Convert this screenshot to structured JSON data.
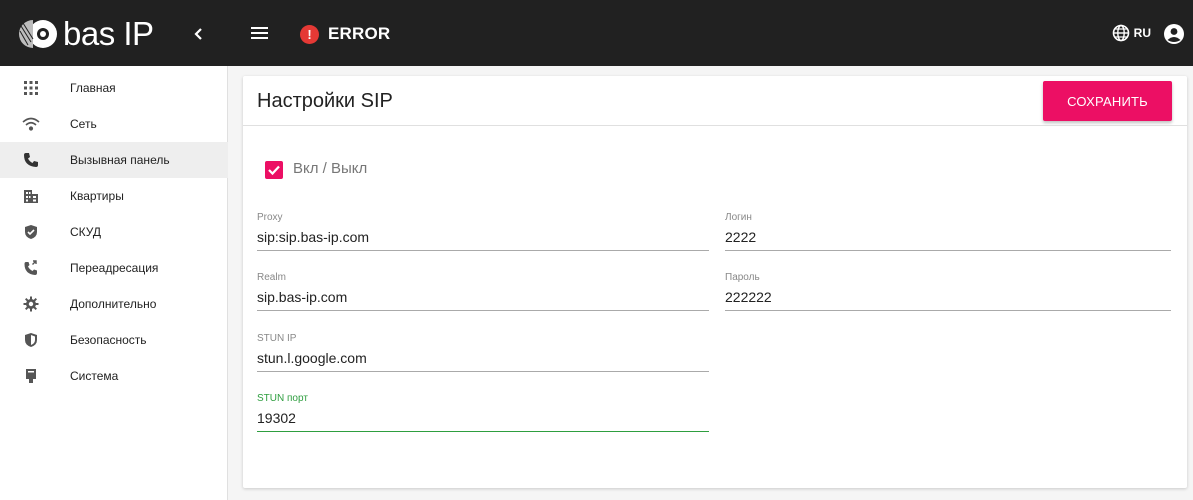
{
  "header": {
    "logo_text": "bas IP",
    "error_label": "ERROR",
    "language": "RU"
  },
  "sidebar": {
    "items": [
      {
        "label": "Главная",
        "icon": "apps-grid-icon",
        "active": false
      },
      {
        "label": "Сеть",
        "icon": "wifi-icon",
        "active": false
      },
      {
        "label": "Вызывная панель",
        "icon": "phone-icon",
        "active": true
      },
      {
        "label": "Квартиры",
        "icon": "building-icon",
        "active": false
      },
      {
        "label": "СКУД",
        "icon": "shield-check-icon",
        "active": false
      },
      {
        "label": "Переадресация",
        "icon": "phone-forward-icon",
        "active": false
      },
      {
        "label": "Дополнительно",
        "icon": "gear-icon",
        "active": false
      },
      {
        "label": "Безопасность",
        "icon": "security-shield-icon",
        "active": false
      },
      {
        "label": "Система",
        "icon": "device-icon",
        "active": false
      }
    ]
  },
  "main": {
    "title": "Настройки SIP",
    "save_label": "СОХРАНИТЬ",
    "enable_label": "Вкл / Выкл",
    "enable_checked": true,
    "fields": {
      "proxy": {
        "label": "Proxy",
        "value": "sip:sip.bas-ip.com"
      },
      "login": {
        "label": "Логин",
        "value": "2222"
      },
      "realm": {
        "label": "Realm",
        "value": "sip.bas-ip.com"
      },
      "password": {
        "label": "Пароль",
        "value": "222222"
      },
      "stun_ip": {
        "label": "STUN IP",
        "value": "stun.l.google.com"
      },
      "stun_port": {
        "label": "STUN порт",
        "value": "19302"
      }
    }
  },
  "colors": {
    "accent": "#ec0f64",
    "focus": "#2e9e3f",
    "topbar": "#212121",
    "error": "#e53935"
  }
}
